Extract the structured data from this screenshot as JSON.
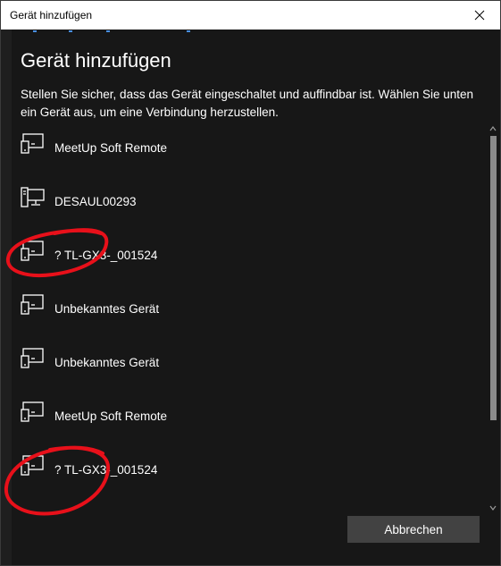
{
  "window": {
    "title": "Gerät hinzufügen",
    "close_icon": "close-icon"
  },
  "main": {
    "heading": "Gerät hinzufügen",
    "description": "Stellen Sie sicher, dass das Gerät eingeschaltet und auffindbar ist. Wählen Sie unten ein Gerät aus, um eine Verbindung herzustellen."
  },
  "devices": [
    {
      "label": "MeetUp Soft Remote",
      "icon": "display-device-icon"
    },
    {
      "label": "DESAUL00293",
      "icon": "computer-icon"
    },
    {
      "label": "? TL-GX3-_001524",
      "icon": "display-device-icon"
    },
    {
      "label": "Unbekanntes Gerät",
      "icon": "display-device-icon"
    },
    {
      "label": "Unbekanntes Gerät",
      "icon": "display-device-icon"
    },
    {
      "label": "MeetUp Soft Remote",
      "icon": "display-device-icon"
    },
    {
      "label": "? TL-GX3-_001524",
      "icon": "display-device-icon"
    }
  ],
  "footer": {
    "cancel_label": "Abbrechen"
  },
  "colors": {
    "background": "#171717",
    "accent": "#4a90e2",
    "annotation": "#e8101a"
  }
}
